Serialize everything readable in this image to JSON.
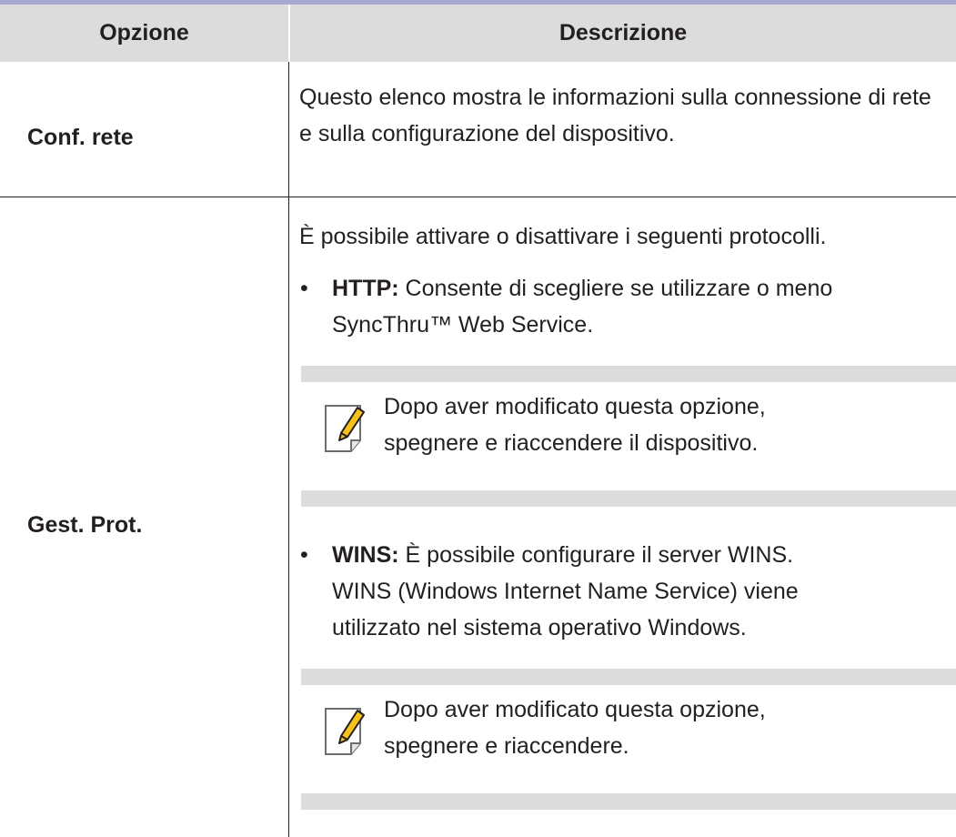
{
  "table": {
    "header_option": "Opzione",
    "header_description": "Descrizione",
    "rows": [
      {
        "option": "Conf. rete",
        "description": "Questo elenco mostra le informazioni sulla connessione di rete e sulla configurazione del dispositivo."
      },
      {
        "option": "Gest. Prot.",
        "intro": "È possibile attivare o disattivare i seguenti protocolli.",
        "items": [
          {
            "term": "HTTP:",
            "text_line1": " Consente di scegliere se utilizzare o meno",
            "text_line2": "SyncThru™ Web Service.",
            "note_line1": "Dopo aver modificato questa opzione,",
            "note_line2": "spegnere e riaccendere il dispositivo."
          },
          {
            "term": "WINS:",
            "text_line1": " È possibile configurare il server WINS.",
            "text_line2": "WINS (Windows Internet Name Service) viene",
            "text_line3": "utilizzato nel sistema operativo Windows.",
            "note_line1": "Dopo aver modificato questa opzione,",
            "note_line2": "spegnere e riaccendere."
          }
        ]
      }
    ]
  },
  "icons": {
    "note": "note-pencil-icon",
    "bullet": "•"
  },
  "colors": {
    "header_bg": "#dcdcde",
    "top_rule": "#a9a8d2",
    "text": "#231f20",
    "note_bar": "#dcdcde",
    "pencil_yellow": "#f6c21a"
  }
}
